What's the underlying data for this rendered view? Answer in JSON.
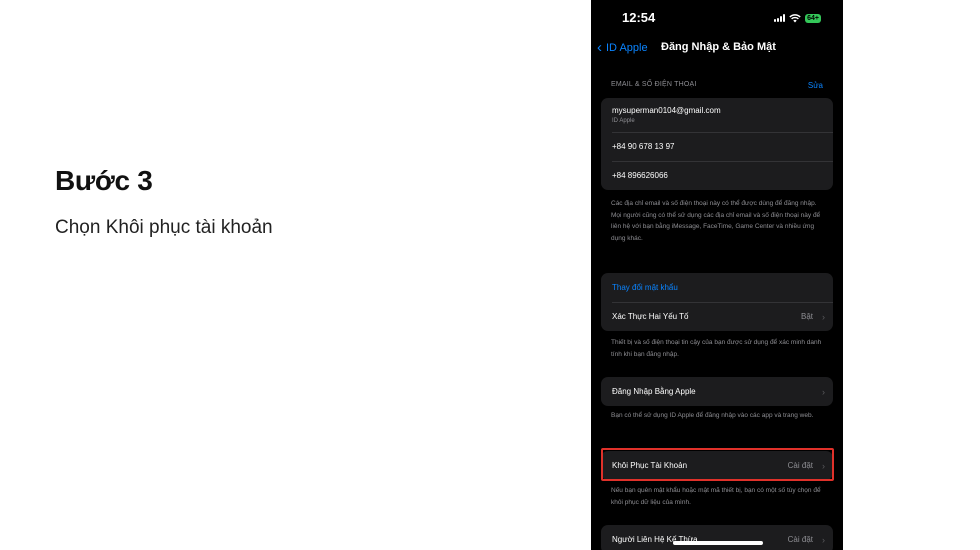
{
  "slide": {
    "title": "Bước 3",
    "subtitle": "Chọn Khôi phục tài khoản"
  },
  "status_bar": {
    "time": "12:54",
    "battery": "64+"
  },
  "nav": {
    "back_label": "ID Apple",
    "title": "Đăng Nhập & Bảo Mật"
  },
  "email_section": {
    "header": "EMAIL & SỐ ĐIỆN THOẠI",
    "edit_label": "Sửa",
    "items": [
      {
        "primary": "mysuperman0104@gmail.com",
        "secondary": "ID Apple"
      },
      {
        "primary": "+84 90 678 13 97"
      },
      {
        "primary": "+84 896626066"
      }
    ],
    "footnote": "Các địa chỉ email và số điện thoại này có thể được dùng để đăng nhập. Mọi người cũng có thể sử dụng các địa chỉ email và số điện thoại này để liên hệ với bạn bằng iMessage, FaceTime, Game Center và nhiều ứng dụng khác."
  },
  "security_section": {
    "change_password": "Thay đổi mật khẩu",
    "two_factor_label": "Xác Thực Hai Yếu Tố",
    "two_factor_value": "Bật",
    "footnote": "Thiết bị và số điện thoại tin cậy của bạn được sử dụng để xác minh danh tính khi bạn đăng nhập."
  },
  "sign_in_apple": {
    "label": "Đăng Nhập Bằng Apple",
    "footnote": "Bạn có thể sử dụng ID Apple để đăng nhập vào các app và trang web."
  },
  "account_recovery": {
    "label": "Khôi Phục Tài Khoản",
    "value": "Cài đặt",
    "footnote": "Nếu bạn quên mật khẩu hoặc mật mã thiết bị, bạn có một số tùy chọn để khôi phục dữ liệu của mình."
  },
  "legacy_contact": {
    "label": "Người Liên Hệ Kế Thừa",
    "value": "Cài đặt"
  },
  "colors": {
    "accent": "#0a84ff",
    "highlight": "#e0312a",
    "background": "#000000",
    "cell": "#1c1c1e"
  }
}
